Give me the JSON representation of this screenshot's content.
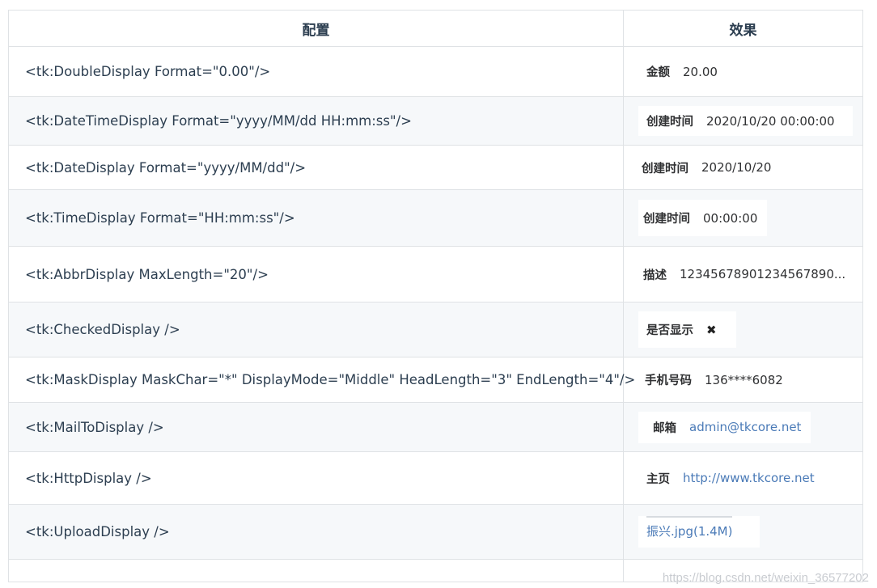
{
  "header": {
    "config": "配置",
    "effect": "效果"
  },
  "rows": [
    {
      "code": "<tk:DoubleDisplay Format=\"0.00\"/>",
      "label": "金额",
      "value": "20.00"
    },
    {
      "code": "<tk:DateTimeDisplay Format=\"yyyy/MM/dd HH:mm:ss\"/>",
      "label": "创建时间",
      "value": "2020/10/20 00:00:00"
    },
    {
      "code": "<tk:DateDisplay Format=\"yyyy/MM/dd\"/>",
      "label": "创建时间",
      "value": "2020/10/20"
    },
    {
      "code": "<tk:TimeDisplay Format=\"HH:mm:ss\"/>",
      "label": "创建时间",
      "value": "00:00:00"
    },
    {
      "code": "<tk:AbbrDisplay MaxLength=\"20\"/>",
      "label": "描述",
      "value": "12345678901234567890..."
    },
    {
      "code": "<tk:CheckedDisplay />",
      "label": "是否显示",
      "value": "✖"
    },
    {
      "code": "<tk:MaskDisplay MaskChar=\"*\" DisplayMode=\"Middle\" HeadLength=\"3\" EndLength=\"4\"/>",
      "label": "手机号码",
      "value": "136****6082"
    },
    {
      "code": "<tk:MailToDisplay />",
      "label": "邮箱",
      "value": "admin@tkcore.net"
    },
    {
      "code": "<tk:HttpDisplay />",
      "label": "主页",
      "value": "http://www.tkcore.net"
    },
    {
      "code": "<tk:UploadDisplay />",
      "label": "",
      "value": "振兴.jpg(1.4M)"
    }
  ],
  "watermark": "https://blog.csdn.net/weixin_36577202"
}
